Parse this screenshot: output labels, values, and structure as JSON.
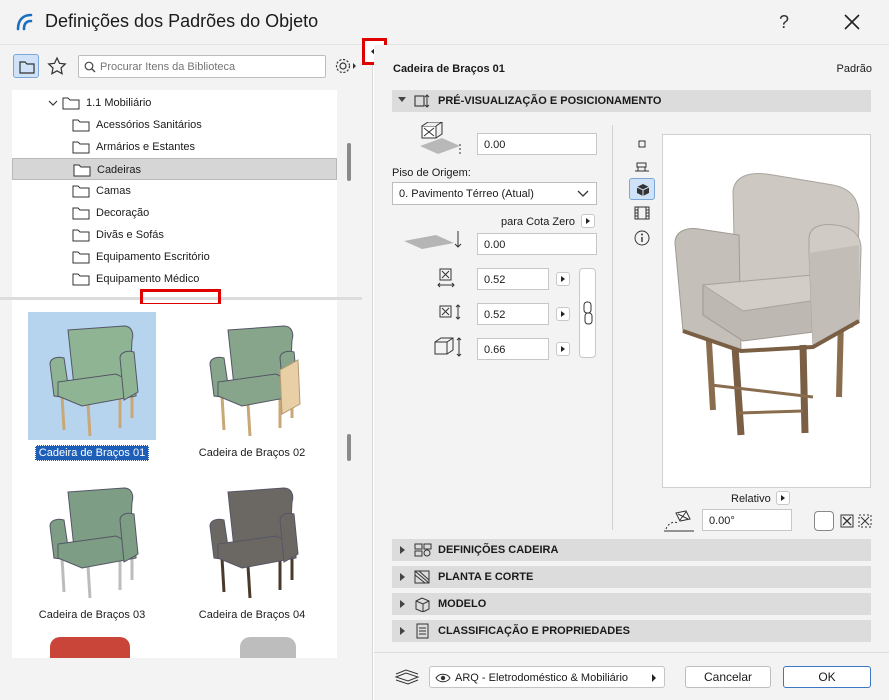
{
  "window": {
    "title": "Definições dos Padrões do Objeto",
    "help_label": "?"
  },
  "library": {
    "search_placeholder": "Procurar Itens da Biblioteca",
    "tree": [
      {
        "label": "1.1 Mobiliário",
        "expanded": true,
        "level": 0
      },
      {
        "label": "Acessórios Sanitários",
        "level": 1
      },
      {
        "label": "Armários e Estantes",
        "level": 1
      },
      {
        "label": "Cadeiras",
        "level": 1,
        "selected": true
      },
      {
        "label": "Camas",
        "level": 1
      },
      {
        "label": "Decoração",
        "level": 1
      },
      {
        "label": "Divãs e Sofás",
        "level": 1
      },
      {
        "label": "Equipamento Escritório",
        "level": 1
      },
      {
        "label": "Equipamento Médico",
        "level": 1
      }
    ],
    "items": [
      {
        "label": "Cadeira de Braços 01",
        "selected": true,
        "color": "#8fb494"
      },
      {
        "label": "Cadeira de Braços 02",
        "color": "#86a58a"
      },
      {
        "label": "Cadeira de Braços 03",
        "color": "#7d9e84"
      },
      {
        "label": "Cadeira de Braços 04",
        "color": "#6b6864"
      }
    ]
  },
  "object": {
    "name": "Cadeira de Braços 01",
    "standard": "Padrão"
  },
  "preview_section": {
    "title": "PRÉ-VISUALIZAÇÃO E POSICIONAMENTO",
    "elevation_value": "0.00",
    "origin_floor_label": "Piso de Origem:",
    "origin_floor_value": "0. Pavimento Térreo (Atual)",
    "to_zero_label": "para Cota Zero",
    "zero_value": "0.00",
    "dim_x": "0.52",
    "dim_y": "0.52",
    "dim_z": "0.66",
    "relative_label": "Relativo",
    "angle_value": "0.00°"
  },
  "sections": [
    {
      "title": "DEFINIÇÕES CADEIRA",
      "icon": "settings-grid-icon"
    },
    {
      "title": "PLANTA E CORTE",
      "icon": "plan-section-icon"
    },
    {
      "title": "MODELO",
      "icon": "model-cube-icon"
    },
    {
      "title": "CLASSIFICAÇÃO E PROPRIEDADES",
      "icon": "list-doc-icon"
    }
  ],
  "footer": {
    "layer_value": "ARQ - Eletrodoméstico & Mobiliário",
    "cancel_label": "Cancelar",
    "ok_label": "OK"
  },
  "colors": {
    "accent": "#1d5fb8",
    "highlight_red": "#e00000",
    "chair_fabric": "#cfcac4",
    "chair_wood": "#8a6d4f"
  }
}
